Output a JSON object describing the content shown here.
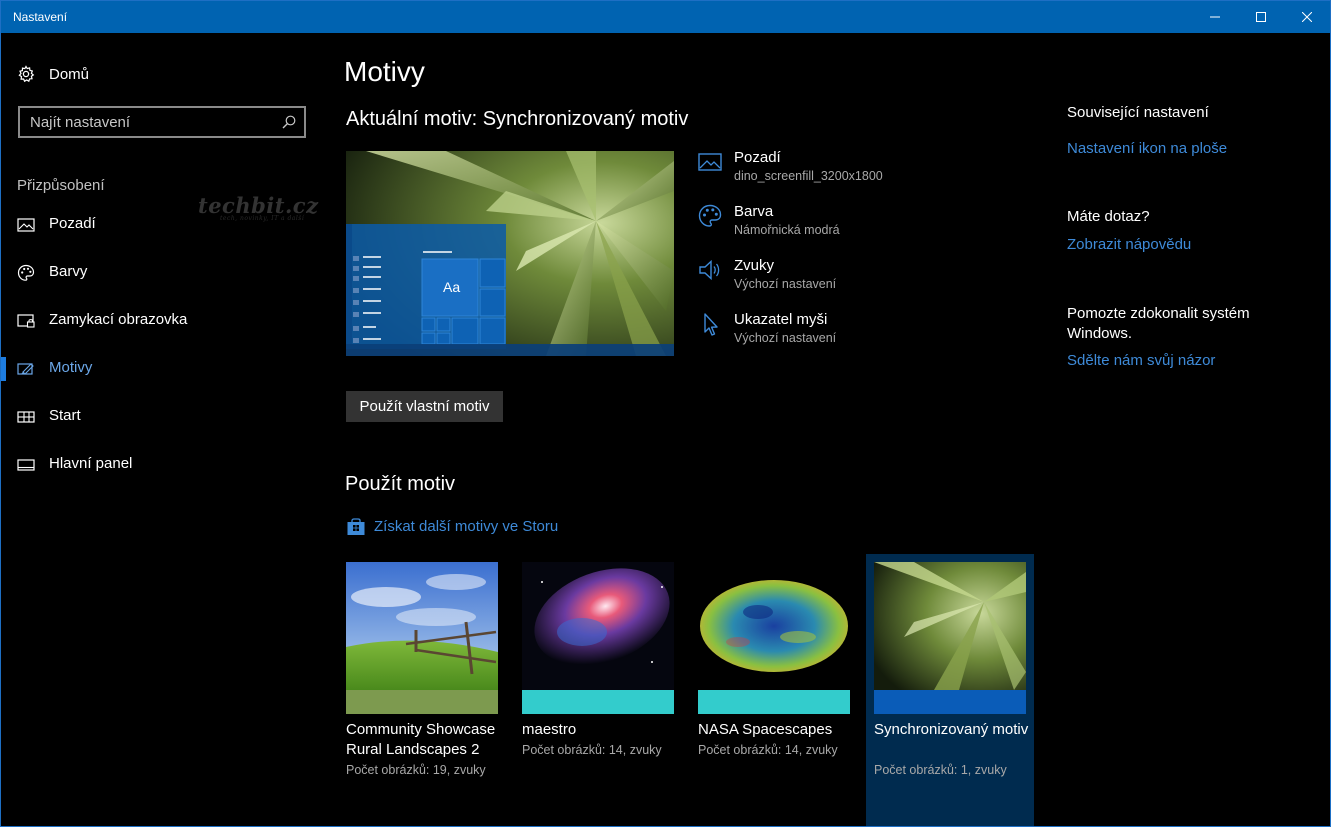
{
  "window": {
    "title": "Nastavení"
  },
  "sidebar": {
    "home_label": "Domů",
    "search_placeholder": "Najít nastavení",
    "section_title": "Přizpůsobení",
    "watermark": "techbit.cz",
    "watermark_sub": "tech, novinky, IT a další",
    "items": [
      {
        "label": "Pozadí",
        "icon": "picture-icon"
      },
      {
        "label": "Barvy",
        "icon": "palette-icon"
      },
      {
        "label": "Zamykací obrazovka",
        "icon": "lock-screen-icon"
      },
      {
        "label": "Motivy",
        "icon": "brush-icon",
        "active": true
      },
      {
        "label": "Start",
        "icon": "start-icon"
      },
      {
        "label": "Hlavní panel",
        "icon": "taskbar-icon"
      }
    ]
  },
  "main": {
    "title": "Motivy",
    "current_theme": "Aktuální motiv: Synchronizovaný motiv",
    "preview_sample": "Aa",
    "properties": [
      {
        "name": "Pozadí",
        "value": "dino_screenfill_3200x1800",
        "icon": "picture-icon"
      },
      {
        "name": "Barva",
        "value": "Námořnická modrá",
        "icon": "palette-icon"
      },
      {
        "name": "Zvuky",
        "value": "Výchozí nastavení",
        "icon": "speaker-icon"
      },
      {
        "name": "Ukazatel myši",
        "value": "Výchozí nastavení",
        "icon": "cursor-icon"
      }
    ],
    "apply_button": "Použít vlastní motiv",
    "use_theme_title": "Použít motiv",
    "store_link": "Získat další motivy ve Storu",
    "themes": [
      {
        "name": "Community Showcase Rural Landscapes 2",
        "info": "Počet obrázků: 19, zvuky",
        "accent": "#7d9a4f"
      },
      {
        "name": "maestro",
        "info": "Počet obrázků: 14, zvuky",
        "accent": "#33cccc"
      },
      {
        "name": "NASA Spacescapes",
        "info": "Počet obrázků: 14, zvuky",
        "accent": "#33cccc"
      },
      {
        "name": "Synchronizovaný motiv",
        "info": "Počet obrázků: 1, zvuky",
        "accent": "#0a5cb8",
        "selected": true
      }
    ]
  },
  "right": {
    "related_title": "Související nastavení",
    "desktop_icons_link": "Nastavení ikon na ploše",
    "question_title": "Máte dotaz?",
    "help_link": "Zobrazit nápovědu",
    "improve_text": "Pomozte zdokonalit systém Windows.",
    "feedback_link": "Sdělte nám svůj názor"
  },
  "colors": {
    "titlebar": "#0063b1",
    "accent_link": "#3e8ad8",
    "active_nav": "#1e7de0"
  }
}
